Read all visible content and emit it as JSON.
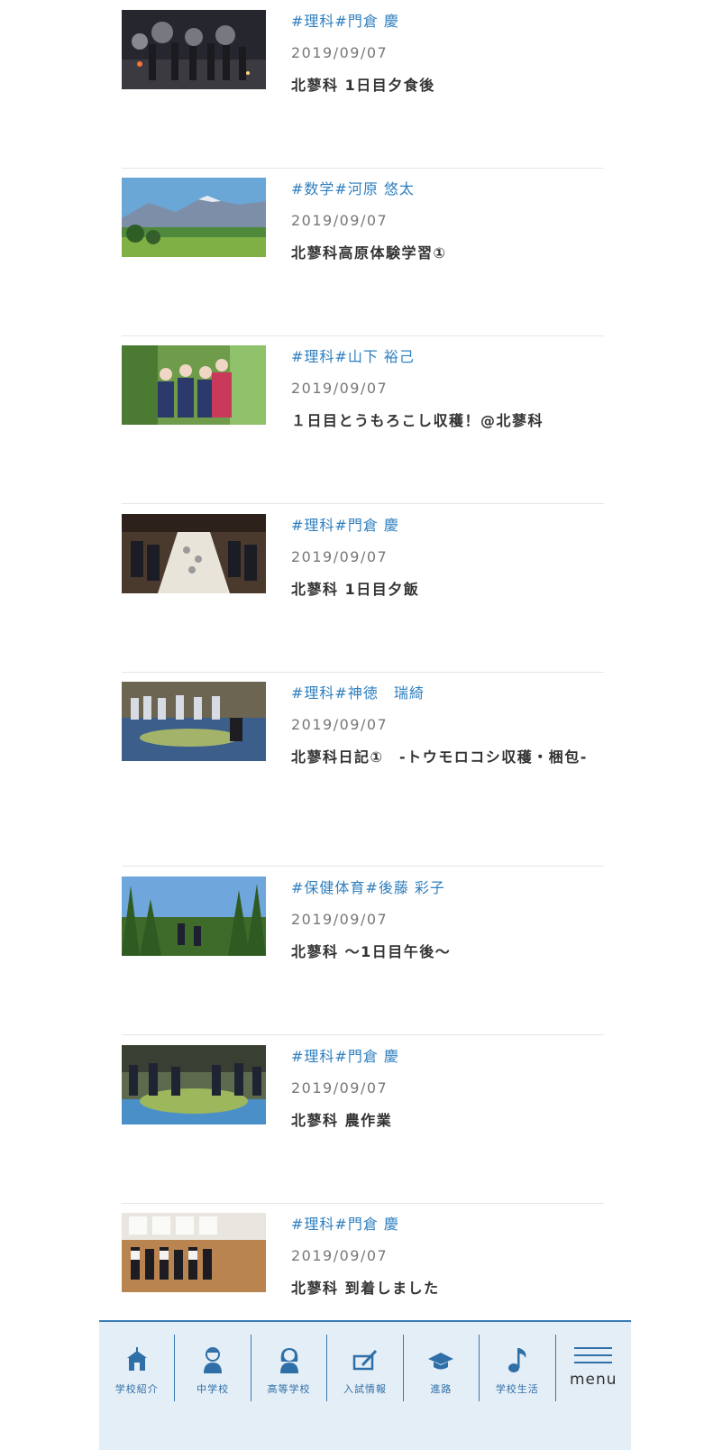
{
  "posts": [
    {
      "tags": [
        "#理科",
        "#門倉 慶"
      ],
      "date": "2019/09/07",
      "title": "北蓼科 1日目夕食後",
      "thumb": "night-sparklers"
    },
    {
      "tags": [
        "#数学",
        "#河原 悠太"
      ],
      "date": "2019/09/07",
      "title": "北蓼科高原体験学習①",
      "thumb": "mountain-landscape"
    },
    {
      "tags": [
        "#理科",
        "#山下 裕己"
      ],
      "date": "2019/09/07",
      "title": "１日目とうもろこし収穫！@北蓼科",
      "thumb": "students-cornfield"
    },
    {
      "tags": [
        "#理科",
        "#門倉 慶"
      ],
      "date": "2019/09/07",
      "title": "北蓼科 1日目夕飯",
      "thumb": "dinner-hall"
    },
    {
      "tags": [
        "#理科",
        "#神徳　瑞綺"
      ],
      "date": "2019/09/07",
      "title": "北蓼科日記①　-トウモロコシ収穫・梱包-",
      "thumb": "corn-on-tarp"
    },
    {
      "tags": [
        "#保健体育",
        "#後藤 彩子"
      ],
      "date": "2019/09/07",
      "title": "北蓼科 ～1日目午後～",
      "thumb": "tall-corn"
    },
    {
      "tags": [
        "#理科",
        "#門倉 慶"
      ],
      "date": "2019/09/07",
      "title": "北蓼科 農作業",
      "thumb": "farm-work"
    },
    {
      "tags": [
        "#理科",
        "#門倉 慶"
      ],
      "date": "2019/09/07",
      "title": "北蓼科 到着しました",
      "thumb": "gymnasium"
    }
  ],
  "nav": {
    "items": [
      {
        "label": "学校紹介",
        "icon": "school-building-icon"
      },
      {
        "label": "中学校",
        "icon": "boy-student-icon"
      },
      {
        "label": "高等学校",
        "icon": "girl-student-icon"
      },
      {
        "label": "入試情報",
        "icon": "pen-notebook-icon"
      },
      {
        "label": "進路",
        "icon": "graduation-cap-icon"
      },
      {
        "label": "学校生活",
        "icon": "music-note-icon"
      }
    ],
    "menu_label": "menu"
  },
  "colors": {
    "accent": "#2f7fbf",
    "nav_background": "#e4eef6",
    "nav_border": "#3a7ab5"
  }
}
